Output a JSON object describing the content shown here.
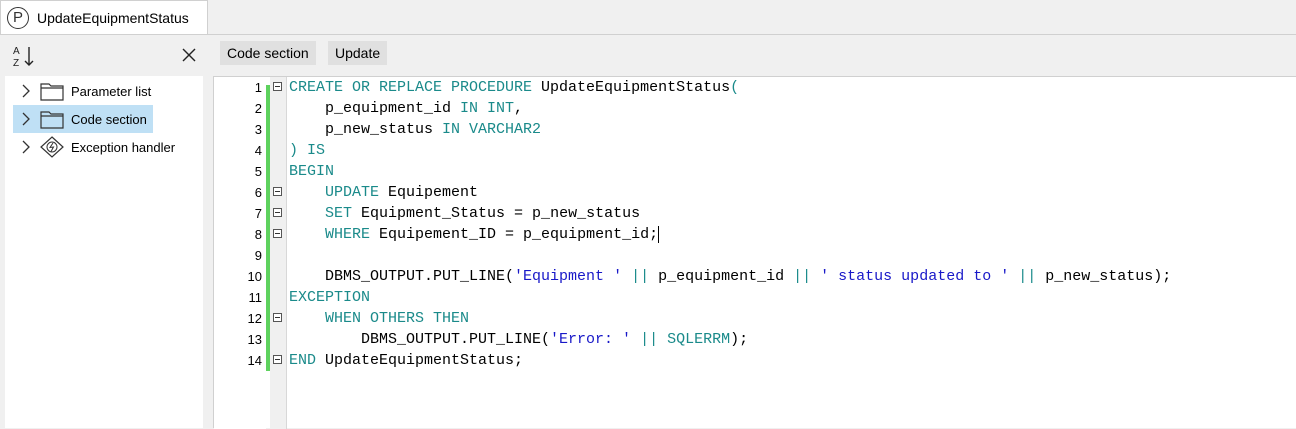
{
  "tab": {
    "title": "UpdateEquipmentStatus",
    "icon": "procedure-p-icon"
  },
  "left_toolbar": {
    "sort_icon": "sort-az-icon",
    "close_icon": "close-icon"
  },
  "tree": {
    "items": [
      {
        "label": "Parameter list",
        "icon": "folder-icon",
        "selected": false
      },
      {
        "label": "Code section",
        "icon": "folder-icon",
        "selected": true
      },
      {
        "label": "Exception handler",
        "icon": "exception-bolt-icon",
        "selected": false
      }
    ]
  },
  "toolbar": {
    "code_section_label": "Code section",
    "update_label": "Update"
  },
  "editor": {
    "line_numbers": [
      "1",
      "2",
      "3",
      "4",
      "5",
      "6",
      "7",
      "8",
      "9",
      "10",
      "11",
      "12",
      "13",
      "14"
    ]
  },
  "colors": {
    "keyword": "#1a8a8a",
    "string": "#1818c8",
    "changed_bar": "#5ed25e",
    "selection": "#bfe0f5"
  }
}
